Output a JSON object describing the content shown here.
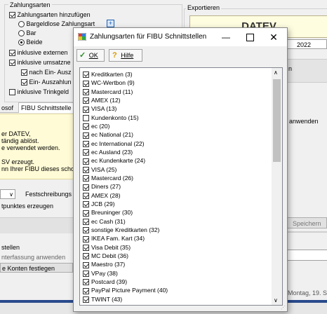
{
  "background": {
    "zahlungsarten_group_label": "Zahlungsarten",
    "zahlungsarten_hinzufuegen": "Zahlungsarten hinzufügen",
    "bargeldlose": "Bargeldlose Zahlungsart",
    "bar": "Bar",
    "beide": "Beide",
    "inkl_externen": "inklusive externen",
    "inkl_umsatzne": "inklusive umsatzne",
    "nach_ein_ausz": "nach Ein- Ausz",
    "ein_auszahlun": "Ein- Auszahlun",
    "inkl_trinkgeld": "inklusive Trinkgeld",
    "exportieren_label": "Exportieren",
    "datev": "DATEV",
    "year_value": "2022",
    "tab_losof": "osof",
    "tab_fibu": "FIBU Schnittstelle z",
    "info_line1": "er DATEV,",
    "info_line2": "tändig ablöst.",
    "info_line3": "e verwendet werden.",
    "info_line4": "SV erzeugt.",
    "info_line5": "nn Ihrer FIBU dieses scho",
    "festschreibung": "Festschreibungs",
    "tpunktes": "tpunktes erzeugen",
    "stellen": "stellen",
    "nterfassung": "nterfassung anwenden",
    "konten": "e Konten festlegen",
    "anwenden_right": "anwenden",
    "speichern_right": "Speichern",
    "status_date": "Montag, 19. S",
    "hash_right": "n"
  },
  "dialog": {
    "title": "Zahlungsarten für FIBU Schnittstellen",
    "ok_label": "OK",
    "help_label": "Hilfe",
    "items": [
      {
        "label": "Kreditkarten (3)",
        "checked": true
      },
      {
        "label": "WC-Wertbon (9)",
        "checked": true
      },
      {
        "label": "Mastercard (11)",
        "checked": true
      },
      {
        "label": "AMEX (12)",
        "checked": true
      },
      {
        "label": "VISA (13)",
        "checked": true
      },
      {
        "label": "Kundenkonto (15)",
        "checked": false
      },
      {
        "label": "ec (20)",
        "checked": true
      },
      {
        "label": "ec National (21)",
        "checked": true
      },
      {
        "label": "ec International (22)",
        "checked": true
      },
      {
        "label": "ec Ausland (23)",
        "checked": true
      },
      {
        "label": "ec Kundenkarte (24)",
        "checked": true
      },
      {
        "label": "VISA (25)",
        "checked": true
      },
      {
        "label": "Mastercard (26)",
        "checked": true
      },
      {
        "label": "Diners (27)",
        "checked": true
      },
      {
        "label": "AMEX (28)",
        "checked": true
      },
      {
        "label": "JCB (29)",
        "checked": true
      },
      {
        "label": "Breuninger (30)",
        "checked": true
      },
      {
        "label": "ec Cash (31)",
        "checked": true
      },
      {
        "label": "sonstige Kreditkarten (32)",
        "checked": true
      },
      {
        "label": "IKEA Fam. Kart (34)",
        "checked": true
      },
      {
        "label": "Visa Debit (35)",
        "checked": true
      },
      {
        "label": "MC Debit (36)",
        "checked": true
      },
      {
        "label": "Maestro (37)",
        "checked": true
      },
      {
        "label": "VPay (38)",
        "checked": true
      },
      {
        "label": "Postcard (39)",
        "checked": true
      },
      {
        "label": "PayPal Picture Payment (40)",
        "checked": true
      },
      {
        "label": "TWINT (43)",
        "checked": true
      }
    ]
  }
}
